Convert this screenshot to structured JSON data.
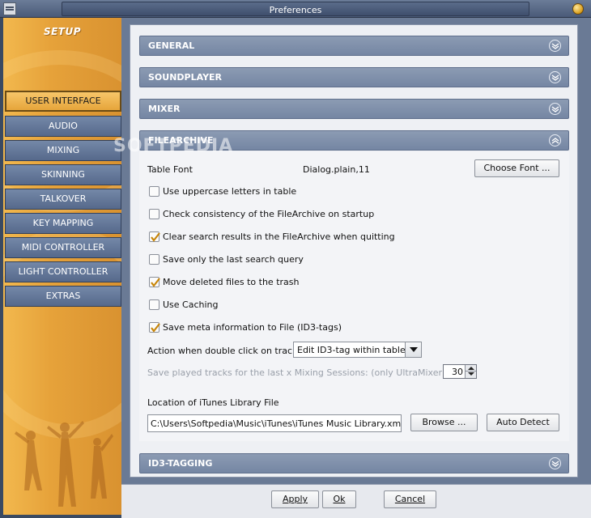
{
  "window": {
    "title": "Preferences"
  },
  "sidebar": {
    "title": "SETUP",
    "items": [
      {
        "label": "USER INTERFACE",
        "active": true
      },
      {
        "label": "AUDIO",
        "active": false
      },
      {
        "label": "MIXING",
        "active": false
      },
      {
        "label": "SKINNING",
        "active": false
      },
      {
        "label": "TALKOVER",
        "active": false
      },
      {
        "label": "KEY MAPPING",
        "active": false
      },
      {
        "label": "MIDI CONTROLLER",
        "active": false
      },
      {
        "label": "LIGHT CONTROLLER",
        "active": false
      },
      {
        "label": "EXTRAS",
        "active": false
      }
    ]
  },
  "sections": {
    "general": {
      "label": "GENERAL",
      "expanded": false
    },
    "soundplayer": {
      "label": "SOUNDPLAYER",
      "expanded": false
    },
    "mixer": {
      "label": "MIXER",
      "expanded": false
    },
    "filearchive": {
      "label": "FILEARCHIVE",
      "expanded": true
    },
    "id3tagging": {
      "label": "ID3-TAGGING",
      "expanded": false
    }
  },
  "filearchive": {
    "table_font_label": "Table Font",
    "table_font_value": "Dialog.plain,11",
    "choose_font_button": "Choose Font ...",
    "options": [
      {
        "label": "Use uppercase letters in table",
        "checked": false
      },
      {
        "label": "Check consistency of the FileArchive on startup",
        "checked": false
      },
      {
        "label": "Clear search results in the FileArchive when quitting",
        "checked": true
      },
      {
        "label": "Save only the last search query",
        "checked": false
      },
      {
        "label": "Move deleted files to the trash",
        "checked": true
      },
      {
        "label": "Use Caching",
        "checked": false
      },
      {
        "label": "Save meta information to File (ID3-tags)",
        "checked": true
      }
    ],
    "double_click_label": "Action when double click on tracks:",
    "double_click_value": "Edit ID3-tag within table",
    "save_played_label": "Save played tracks for the last x Mixing Sessions: (only UltraMixer Basic)",
    "save_played_value": "30",
    "itunes_label": "Location of iTunes Library File",
    "itunes_path": "C:\\Users\\Softpedia\\Music\\iTunes\\iTunes Music Library.xml",
    "browse_button": "Browse ...",
    "auto_detect_button": "Auto Detect"
  },
  "footer": {
    "apply": "Apply",
    "ok": "Ok",
    "cancel": "Cancel"
  },
  "watermark": "SOFTPEDIA",
  "colors": {
    "accent_orange": "#e6a23a",
    "header_blue": "#7a8aa6",
    "checkmark": "#c8860a"
  },
  "icons": {
    "app": "app-logo-icon",
    "close": "close-orb-icon",
    "expand": "chevron-down-circle-icon",
    "collapse": "chevron-up-circle-icon"
  }
}
